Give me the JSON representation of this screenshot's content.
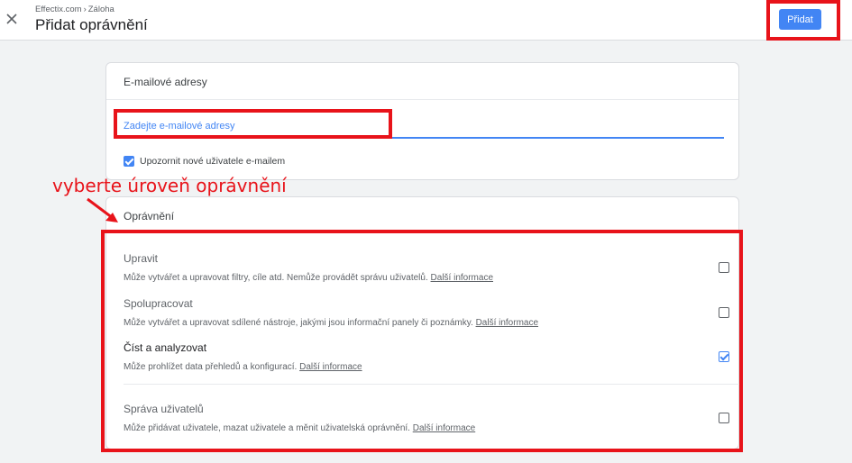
{
  "header": {
    "breadcrumb_account": "Effectix.com",
    "breadcrumb_property": "Záloha",
    "title": "Přidat oprávnění",
    "add_label": "Přidat"
  },
  "email_section": {
    "heading": "E-mailové adresy",
    "input_placeholder": "Zadejte e-mailové adresy",
    "input_value": "",
    "notify_label": "Upozornit nové uživatele e-mailem",
    "notify_checked": true
  },
  "permissions_section": {
    "heading": "Oprávnění",
    "items": [
      {
        "title": "Upravit",
        "description": "Může vytvářet a upravovat filtry, cíle atd. Nemůže provádět správu uživatelů.",
        "link": "Další informace",
        "checked": false
      },
      {
        "title": "Spolupracovat",
        "description": "Může vytvářet a upravovat sdílené nástroje, jakými jsou informační panely či poznámky.",
        "link": "Další informace",
        "checked": false
      },
      {
        "title": "Číst a analyzovat",
        "description": "Může prohlížet data přehledů a konfigurací.",
        "link": "Další informace",
        "checked": true
      },
      {
        "title": "Správa uživatelů",
        "description": "Může přidávat uživatele, mazat uživatele a měnit uživatelská oprávnění.",
        "link": "Další informace",
        "checked": false
      }
    ]
  },
  "annotation": {
    "text": "vyberte úroveň oprávnění",
    "color": "#e8131a"
  },
  "colors": {
    "accent": "#4285f4",
    "highlight": "#e8131a"
  },
  "icons": {
    "close": "close-icon",
    "more": "more-vert-icon"
  }
}
